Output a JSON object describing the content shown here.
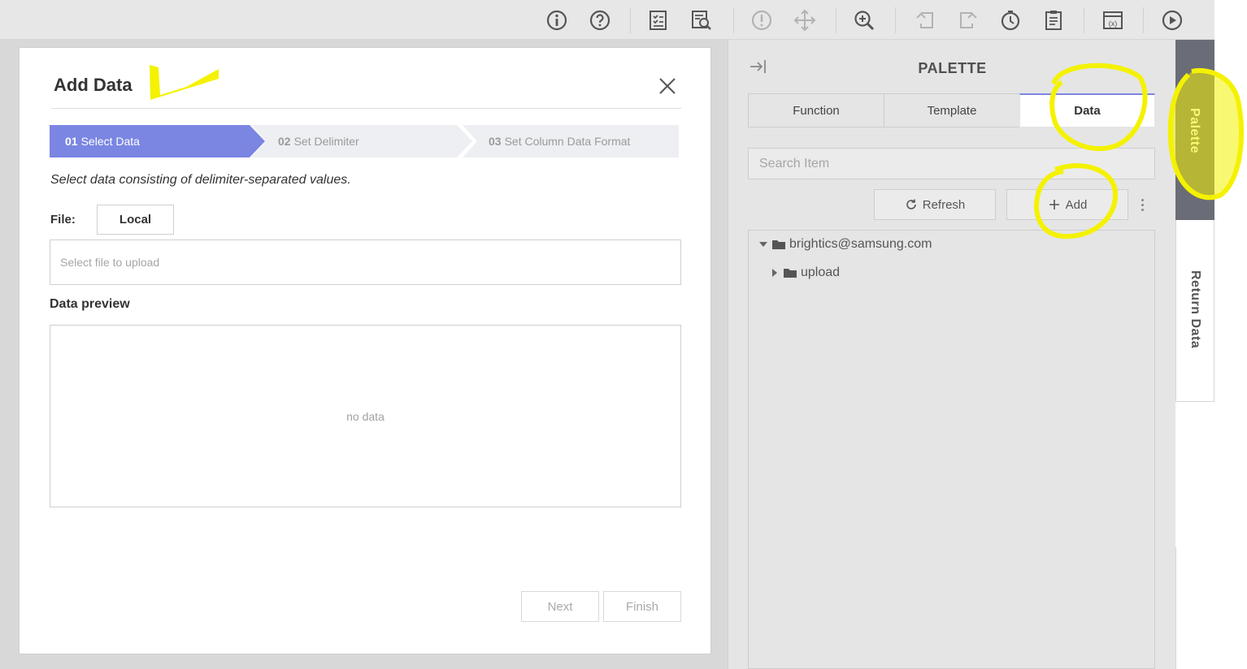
{
  "dialog": {
    "title": "Add Data",
    "steps": [
      {
        "num": "01",
        "label": "Select Data"
      },
      {
        "num": "02",
        "label": "Set Delimiter"
      },
      {
        "num": "03",
        "label": "Set Column Data Format"
      }
    ],
    "instruction": "Select data consisting of delimiter-separated values.",
    "file_label": "File:",
    "local_button": "Local",
    "file_placeholder": "Select file to upload",
    "preview_label": "Data preview",
    "no_data": "no data",
    "next_button": "Next",
    "finish_button": "Finish"
  },
  "palette": {
    "title": "PALETTE",
    "tabs": [
      "Function",
      "Template",
      "Data"
    ],
    "active_tab": "Data",
    "search_placeholder": "Search Item",
    "refresh_button": "Refresh",
    "add_button": "Add",
    "tree": [
      {
        "label": "brightics@samsung.com",
        "expanded": true
      },
      {
        "label": "upload",
        "expanded": false
      }
    ]
  },
  "side_tabs": {
    "palette": "Palette",
    "return_data": "Return Data"
  },
  "toolbar_icons": [
    "info-icon",
    "help-icon",
    "report-icon",
    "report-search-icon",
    "validate-icon",
    "move-icon",
    "zoom-icon",
    "undo-icon",
    "redo-icon",
    "history-icon",
    "clipboard-icon",
    "variables-icon",
    "run-icon"
  ],
  "colors": {
    "accent": "#7b86e3",
    "side_tab_active": "#6a6c78",
    "highlight": "#f4f200"
  }
}
